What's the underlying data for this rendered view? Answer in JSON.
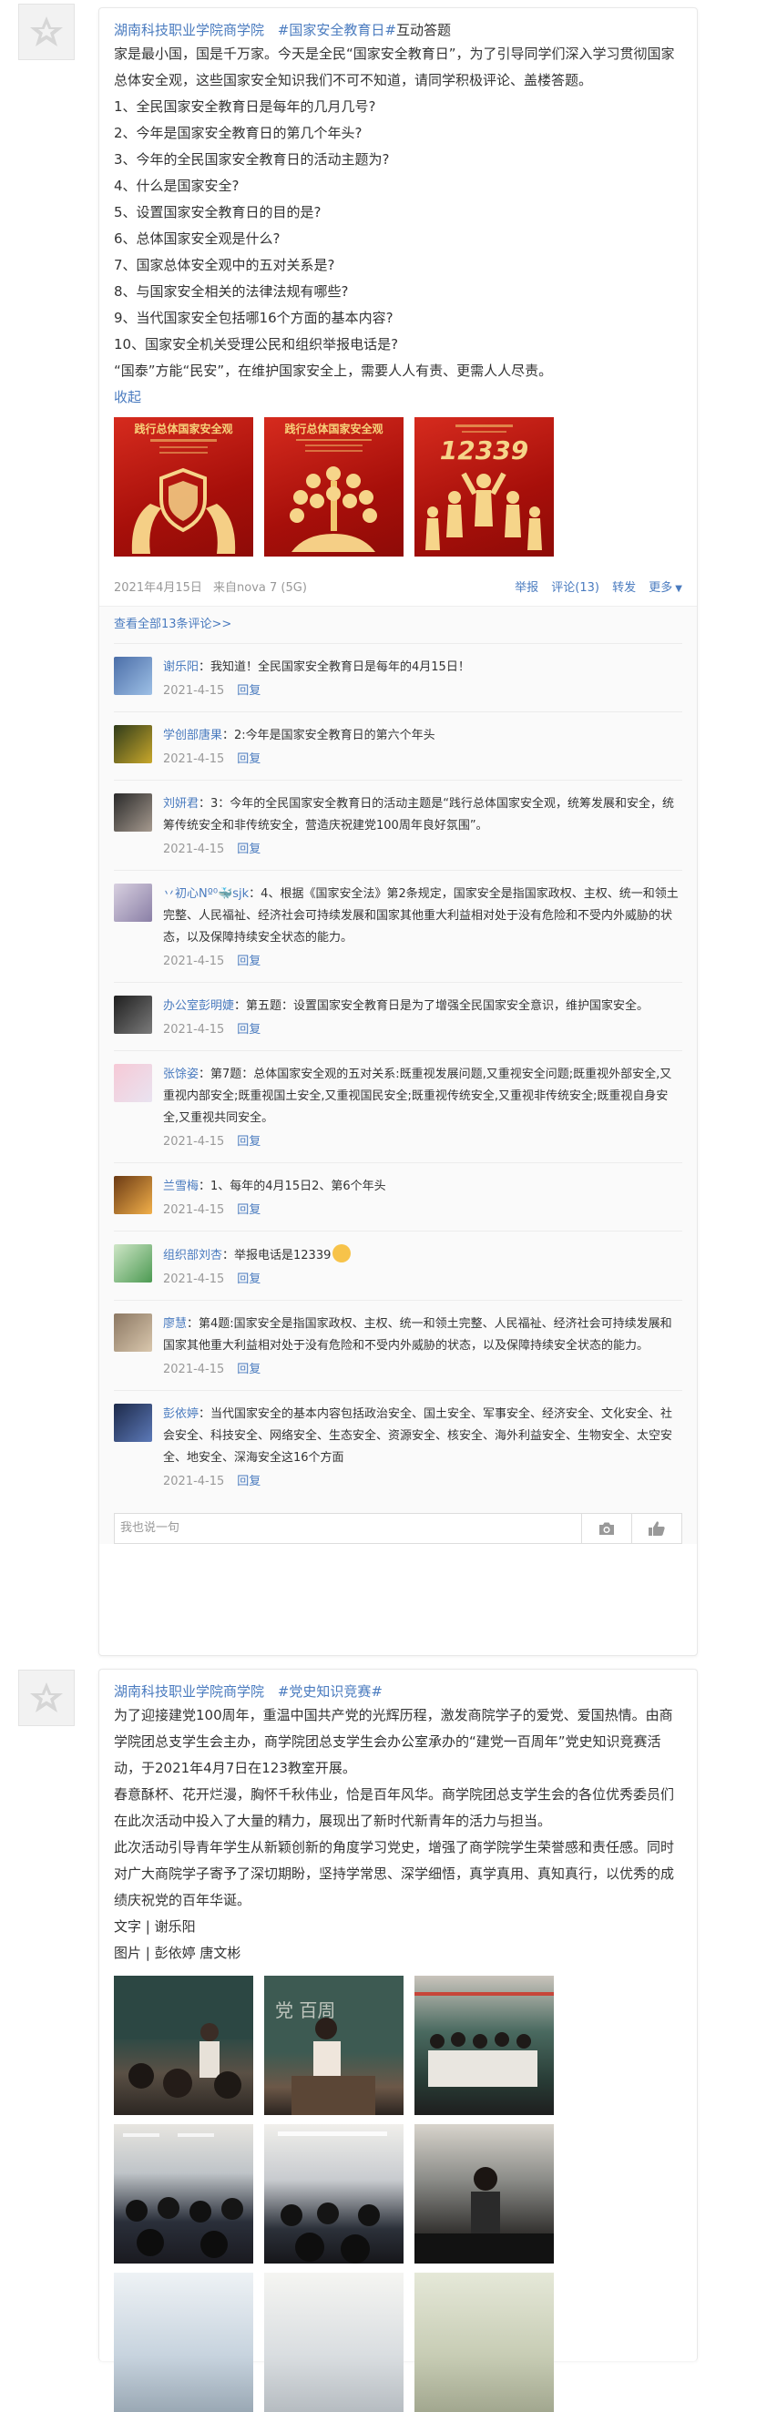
{
  "post1": {
    "author": "湖南科技职业学院商学院",
    "topic": "#国家安全教育日#",
    "topic_suffix": "互动答题",
    "lines": [
      " 家是最小国，国是千万家。今天是全民“国家安全教育日”，为了引导同学们深入学习贯彻国家总体安全观，这些国家安全知识我们不可不知道，请同学积极评论、盖楼答题。",
      "1、全民国家安全教育日是每年的几月几号?",
      "2、今年是国家安全教育日的第几个年头?",
      "3、今年的全民国家安全教育日的活动主题为?",
      "4、什么是国家安全?",
      "5、设置国家安全教育日的目的是?",
      "6、总体国家安全观是什么?",
      "7、国家总体安全观中的五对关系是?",
      "8、与国家安全相关的法律法规有哪些?",
      "9、当代国家安全包括哪16个方面的基本内容?",
      "10、国家安全机关受理公民和组织举报电话是?",
      " “国泰”方能“民安”，在维护国家安全上，需要人人有责、更需人人尽责。"
    ],
    "collapse": "收起",
    "image_titles": [
      "践行总体国家安全观",
      "践行总体国家安全观",
      "12339"
    ],
    "date": "2021年4月15日",
    "source": "来自nova 7 (5G)",
    "actions": {
      "report": "举报",
      "comment": "评论(13)",
      "forward": "转发",
      "more": "更多"
    },
    "view_all": "查看全部13条评论>>",
    "comments": [
      {
        "name": "谢乐阳",
        "text": "：我知道！全民国家安全教育日是每年的4月15日！",
        "date": "2021-4-15",
        "reply": "回复"
      },
      {
        "name": "学创部唐果",
        "text": "：2:今年是国家安全教育日的第六个年头",
        "date": "2021-4-15",
        "reply": "回复"
      },
      {
        "name": "刘妍君",
        "text": "：3：今年的全民国家安全教育日的活动主题是“践行总体国家安全观，统筹发展和安全，统筹传统安全和非传统安全，营造庆祝建党100周年良好氛围”。",
        "date": "2021-4-15",
        "reply": "回复"
      },
      {
        "name": "丷初心Nº⁰🐳sjk",
        "text": "：4、根据《国家安全法》第2条规定，国家安全是指国家政权、主权、统一和领土完整、人民福祉、经济社会可持续发展和国家其他重大利益相对处于没有危险和不受内外威胁的状态，以及保障持续安全状态的能力。",
        "date": "2021-4-15",
        "reply": "回复"
      },
      {
        "name": "办公室彭明婕",
        "text": "：第五题：设置国家安全教育日是为了增强全民国家安全意识，维护国家安全。",
        "date": "2021-4-15",
        "reply": "回复"
      },
      {
        "name": "张馀姿",
        "text": "：第7题：总体国家安全观的五对关系:既重视发展问题,又重视安全问题;既重视外部安全,又重视内部安全;既重视国土安全,又重视国民安全;既重视传统安全,又重视非传统安全;既重视自身安全,又重视共同安全。",
        "date": "2021-4-15",
        "reply": "回复"
      },
      {
        "name": "兰雪梅",
        "text": "：1、每年的4月15日2、第6个年头",
        "date": "2021-4-15",
        "reply": "回复"
      },
      {
        "name": "组织部刘杏",
        "text": "：举报电话是12339",
        "date": "2021-4-15",
        "reply": "回复"
      },
      {
        "name": "廖慧",
        "text": "：第4题:国家安全是指国家政权、主权、统一和领土完整、人民福祉、经济社会可持续发展和国家其他重大利益相对处于没有危险和不受内外威胁的状态，以及保障持续安全状态的能力。",
        "date": "2021-4-15",
        "reply": "回复"
      },
      {
        "name": "彭依婷",
        "text": "：当代国家安全的基本内容包括政治安全、国土安全、军事安全、经济安全、文化安全、社会安全、科技安全、网络安全、生态安全、资源安全、核安全、海外利益安全、生物安全、太空安全、地安全、深海安全这16个方面",
        "date": "2021-4-15",
        "reply": "回复"
      }
    ],
    "reply_placeholder": "我也说一句"
  },
  "post2": {
    "author": "湖南科技职业学院商学院",
    "topic": "#党史知识竞赛#",
    "lines": [
      " 为了迎接建党100周年，重温中国共产党的光辉历程，激发商院学子的爱党、爱国热情。由商学院团总支学生会主办，商学院团总支学生会办公室承办的“建党一百周年”党史知识竞赛活动，于2021年4月7日在123教室开展。",
      " 春意酥杯、花开烂漫，胸怀千秋伟业，恰是百年风华。商学院团总支学生会的各位优秀委员们在此次活动中投入了大量的精力，展现出了新时代新青年的活力与担当。",
      " 此次活动引导青年学生从新颖创新的角度学习党史，增强了商学院学生荣誉感和责任感。同时对广大商院学子寄予了深切期盼，坚持学常思、深学细悟，真学真用、真知真行，以优秀的成绩庆祝党的百年华诞。",
      "文字 | 谢乐阳",
      "图片 | 彭依婷 唐文彬"
    ]
  }
}
